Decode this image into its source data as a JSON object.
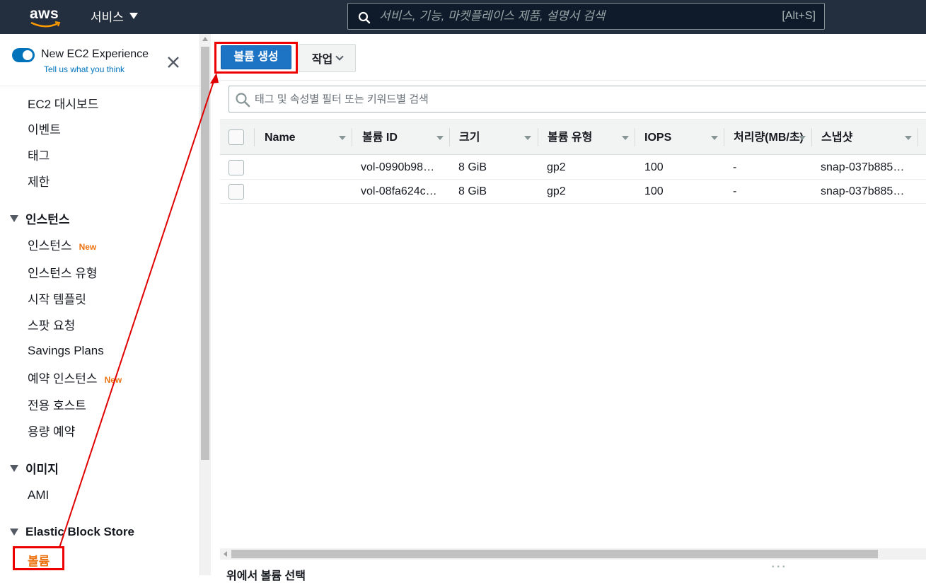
{
  "topnav": {
    "logo_text": "aws",
    "services_label": "서비스",
    "search_placeholder": "서비스, 기능, 마켓플레이스 제품, 설명서 검색",
    "search_shortcut": "[Alt+S]"
  },
  "sidebar": {
    "new_experience_label": "New EC2 Experience",
    "feedback_link": "Tell us what you think",
    "top_items": [
      {
        "label": "EC2 대시보드"
      },
      {
        "label": "이벤트"
      },
      {
        "label": "태그"
      },
      {
        "label": "제한"
      }
    ],
    "sections": [
      {
        "title": "인스턴스",
        "items": [
          {
            "label": "인스턴스",
            "badge": "New"
          },
          {
            "label": "인스턴스 유형"
          },
          {
            "label": "시작 템플릿"
          },
          {
            "label": "스팟 요청"
          },
          {
            "label": "Savings Plans"
          },
          {
            "label": "예약 인스턴스",
            "badge": "New"
          },
          {
            "label": "전용 호스트"
          },
          {
            "label": "용량 예약"
          }
        ]
      },
      {
        "title": "이미지",
        "items": [
          {
            "label": "AMI"
          }
        ]
      },
      {
        "title": "Elastic Block Store",
        "items": [
          {
            "label": "볼륨",
            "active": true
          }
        ]
      }
    ]
  },
  "toolbar": {
    "create_volume_label": "볼륨 생성",
    "actions_label": "작업"
  },
  "filter": {
    "placeholder": "태그 및 속성별 필터 또는 키워드별 검색"
  },
  "table": {
    "columns": [
      "Name",
      "볼륨 ID",
      "크기",
      "볼륨 유형",
      "IOPS",
      "처리량(MB/초)",
      "스냅샷"
    ],
    "rows": [
      {
        "name": "",
        "volume_id": "vol-0990b98…",
        "size": "8 GiB",
        "type": "gp2",
        "iops": "100",
        "throughput": "-",
        "snapshot": "snap-037b885…"
      },
      {
        "name": "",
        "volume_id": "vol-08fa624c…",
        "size": "8 GiB",
        "type": "gp2",
        "iops": "100",
        "throughput": "-",
        "snapshot": "snap-037b885…"
      }
    ]
  },
  "footer": {
    "selection_text": "위에서 볼륨 선택"
  },
  "colors": {
    "nav_bg": "#232f3e",
    "primary_button": "#1e74c4",
    "accent_orange": "#ec7211",
    "link_blue": "#0073bb",
    "annotation_red": "#e00000"
  }
}
